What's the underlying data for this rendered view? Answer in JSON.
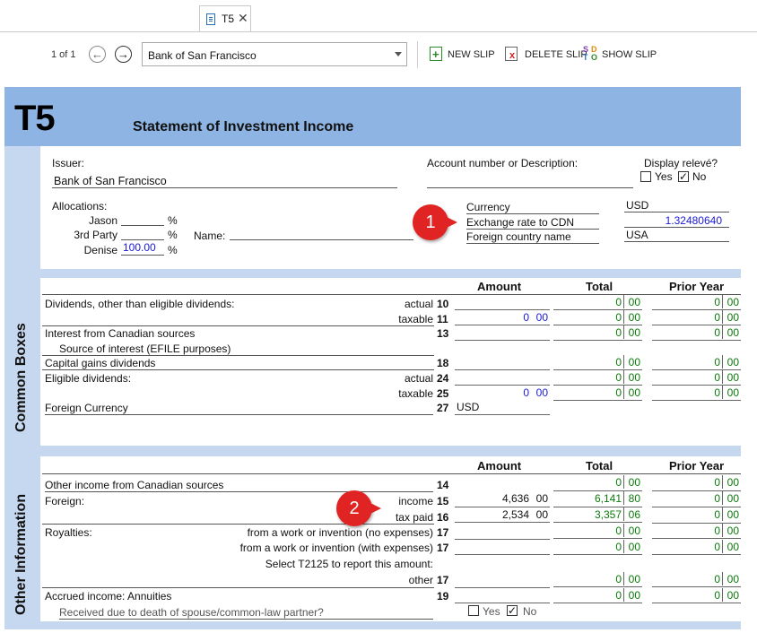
{
  "tab": {
    "label": "T5",
    "close": "✕"
  },
  "toolbar": {
    "pager": "1 of 1",
    "issuer_value": "Bank of San Francisco",
    "new_slip": "NEW SLIP",
    "delete_slip": "DELETE SLIP",
    "show_slip": "SHOW SLIP"
  },
  "form": {
    "code": "T5",
    "title": "Statement of Investment Income"
  },
  "issuer_section": {
    "issuer_label": "Issuer:",
    "issuer_value": "Bank of San Francisco",
    "account_label": "Account number or Description:",
    "display_releve_label": "Display relevé?",
    "yes": "Yes",
    "no": "No",
    "allocations_label": "Allocations:",
    "alloc": [
      {
        "name": "Jason",
        "value": "",
        "pct": "%"
      },
      {
        "name": "3rd Party",
        "value": "",
        "pct": "%"
      },
      {
        "name": "Denise",
        "value": "100.00",
        "pct": "%"
      }
    ],
    "name_label": "Name:",
    "currency_label": "Currency",
    "currency_value": "USD",
    "exchange_label": "Exchange rate to CDN",
    "exchange_value": "1.32480640",
    "foreign_country_label": "Foreign country name",
    "foreign_country_value": "USA"
  },
  "markers": [
    "1",
    "2"
  ],
  "common": {
    "side_label": "Common Boxes",
    "col_amount": "Amount",
    "col_total": "Total",
    "col_prior": "Prior Year",
    "rows": [
      {
        "label": "Dividends, other than eligible dividends:",
        "sub": "actual",
        "box": "10"
      },
      {
        "label": "",
        "sub": "taxable",
        "box": "11"
      },
      {
        "label": "Interest from Canadian sources",
        "sub": "",
        "box": "13"
      },
      {
        "label": "Source of interest (EFILE purposes)",
        "sub": "",
        "box": ""
      },
      {
        "label": "Capital gains dividends",
        "sub": "",
        "box": "18"
      },
      {
        "label": "Eligible dividends:",
        "sub": "actual",
        "box": "24"
      },
      {
        "label": "",
        "sub": "taxable",
        "box": "25"
      },
      {
        "label": "Foreign Currency",
        "sub": "",
        "box": "27"
      }
    ],
    "amount_11": [
      "0",
      "00"
    ],
    "amount_25": [
      "0",
      "00"
    ],
    "foreign_currency": "USD",
    "zero_int": "0",
    "zero_dec": "00"
  },
  "other": {
    "side_label": "Other Information",
    "col_amount": "Amount",
    "col_total": "Total",
    "col_prior": "Prior Year",
    "rows": [
      {
        "label": "Other income from Canadian sources",
        "sub": "",
        "box": "14"
      },
      {
        "label": "Foreign:",
        "sub": "income",
        "box": "15"
      },
      {
        "label": "",
        "sub": "tax paid",
        "box": "16"
      },
      {
        "label": "Royalties:",
        "sub": "from a work or invention (no expenses)",
        "box": "17"
      },
      {
        "label": "",
        "sub": "from a work or invention (with expenses)",
        "box": "17"
      },
      {
        "label": "",
        "sub": "Select T2125 to report this amount:",
        "box": ""
      },
      {
        "label": "",
        "sub": "other",
        "box": "17"
      },
      {
        "label": "Accrued income: Annuities",
        "sub": "",
        "box": "19"
      },
      {
        "label": "Received due to death of spouse/common-law partner?",
        "sub": "",
        "box": ""
      }
    ],
    "income_amount": [
      "4,636",
      "00"
    ],
    "income_total": [
      "6,141",
      "80"
    ],
    "taxpaid_amount": [
      "2,534",
      "00"
    ],
    "taxpaid_total": [
      "3,357",
      "06"
    ],
    "yes": "Yes",
    "no": "No",
    "zero_int": "0",
    "zero_dec": "00"
  }
}
